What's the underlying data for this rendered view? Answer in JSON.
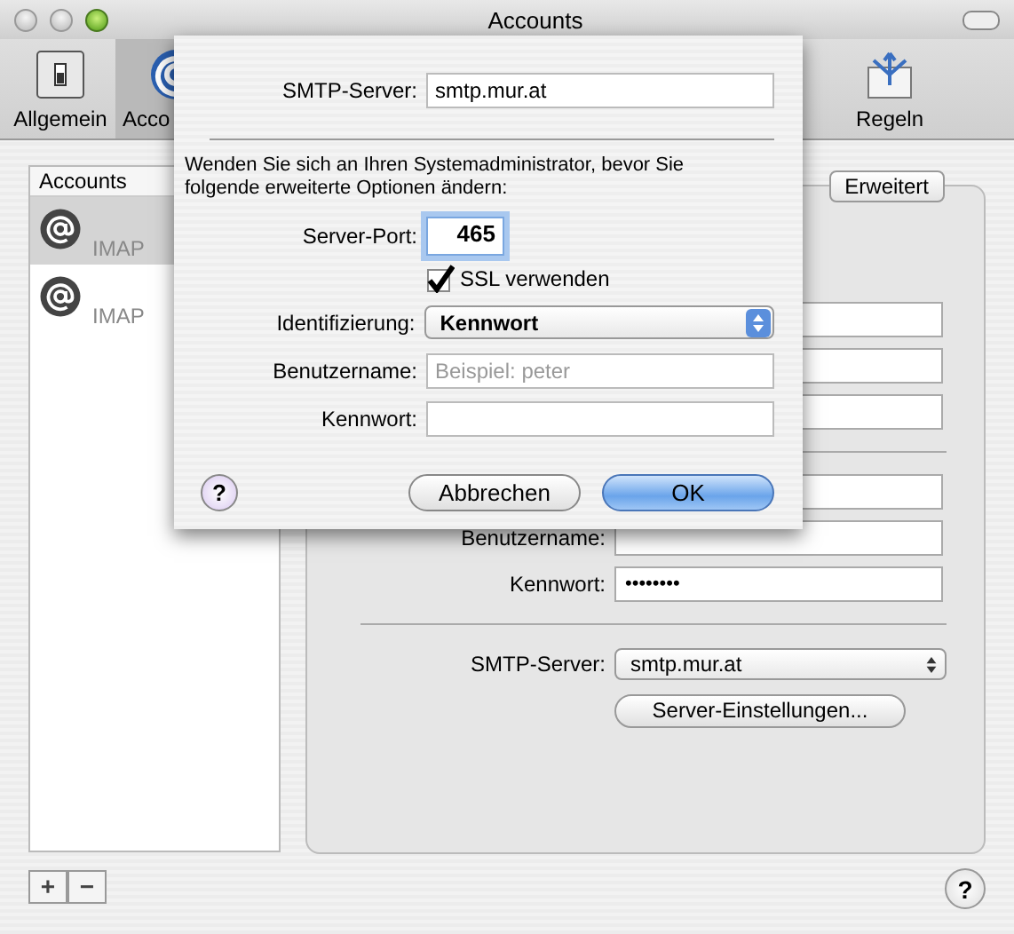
{
  "window": {
    "title": "Accounts"
  },
  "toolbar": [
    {
      "kind": "switch",
      "label": "Allgemein",
      "selected": false
    },
    {
      "kind": "at",
      "label": "Acco",
      "selected": true
    },
    {
      "kind": "rules",
      "label": "Regeln",
      "selected": false
    }
  ],
  "accounts_list": {
    "header": "Accounts",
    "items": [
      {
        "name": "IMAP",
        "selected": true
      },
      {
        "name": "IMAP",
        "selected": false
      }
    ]
  },
  "list_buttons": [
    "+",
    "−"
  ],
  "help_button": "?",
  "panel": {
    "tab": {
      "label": "Erweitert",
      "selected": false
    },
    "rows": [
      {
        "kind": "field"
      },
      {
        "kind": "field"
      },
      {
        "kind": "field"
      },
      {
        "kind": "separator"
      },
      {
        "kind": "field"
      },
      {
        "kind": "field",
        "label": "Benutzername:"
      },
      {
        "kind": "field",
        "label": "Kennwort:",
        "value": "••••••••"
      },
      {
        "kind": "separator"
      },
      {
        "kind": "popup",
        "label": "SMTP-Server:",
        "value": "smtp.mur.at"
      },
      {
        "kind": "button",
        "value": "Server-Einstellungen..."
      }
    ]
  },
  "sheet": {
    "smtp": {
      "label": "SMTP-Server:",
      "value": "smtp.mur.at"
    },
    "message": "Wenden Sie sich an Ihren Systemadministrator, bevor Sie folgende erweiterte Optionen ändern:",
    "port": {
      "label": "Server-Port:",
      "value": "465"
    },
    "ssl": {
      "label": "SSL verwenden",
      "checked": true
    },
    "auth": {
      "label": "Identifizierung:",
      "value": "Kennwort"
    },
    "username": {
      "label": "Benutzername:",
      "placeholder": "Beispiel: peter"
    },
    "password": {
      "label": "Kennwort:"
    },
    "help_button": "?",
    "buttons": [
      {
        "label": "Abbrechen",
        "default": false
      },
      {
        "label": "OK",
        "default": true
      }
    ]
  }
}
